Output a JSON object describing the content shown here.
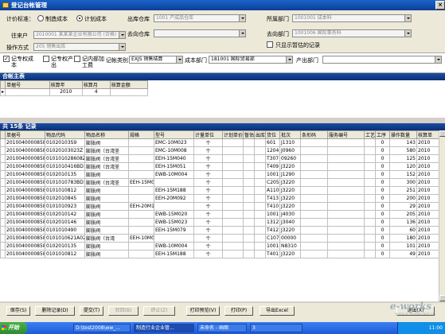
{
  "window": {
    "title": "登记台帐管理"
  },
  "form": {
    "pricing_label": "计价标准：",
    "pricing_options": [
      "制造成本",
      "计划成本"
    ],
    "from_warehouse_label": "出库仓库",
    "from_warehouse_value": "1001 产成品仓库",
    "department_label": "所属部门",
    "department_value": "1001001 成本科",
    "partner_label": "往来户",
    "partner_value": "2010001 某某某企业有限公司 (合格)",
    "to_warehouse_label": "去向仓库",
    "to_warehouse_value": "",
    "to_department_label": "去向部门",
    "to_department_value": "1001006 国际事务科",
    "operation_label": "操作方式",
    "operation_value": "205 销售出库",
    "only_unregistered_label": "只显示暂估的记录"
  },
  "band": {
    "record_cost_label": "记专权成本",
    "exclude_label": "记专权产出",
    "record_processing_label": "记内部加工费",
    "type_label": "记帐类别",
    "type_value": "EXJS 销售结算",
    "cost_dept_label": "成本部门",
    "cost_dept_value": "181001 国际贸易部",
    "output_dept_label": "产出部门",
    "output_dept_value": ""
  },
  "summary": {
    "title": "合帐主表",
    "headers": [
      "单据号",
      "核算年",
      "核算月",
      "核算金额"
    ],
    "rows": [
      [
        "",
        "2010",
        "4",
        ""
      ]
    ]
  },
  "detail": {
    "title": "共 15条 记录",
    "headers": [
      "单据号",
      "物品代码",
      "物品名称",
      "规格",
      "型号",
      "计量单位",
      "计划单价",
      "暂估",
      "出库",
      "货位",
      "批次",
      "条形码",
      "服务编号",
      "工艺",
      "工序",
      "操作数量",
      "核算单"
    ],
    "rows": [
      [
        "2010040000858",
        "01020103S9",
        "膨胀阀",
        "",
        "EMC-10M023",
        "个",
        "",
        "",
        "",
        "601",
        "J1310",
        "",
        "",
        "",
        "0",
        "143",
        "2010"
      ],
      [
        "2010040000858",
        "01020103023Z",
        "膨胀阀（台湾荃",
        "",
        "EMC-10M008",
        "个",
        "",
        "",
        "",
        "1204",
        "J0960",
        "",
        "",
        "",
        "0",
        "580",
        "2010"
      ],
      [
        "2010040000858",
        "010101028608Z",
        "膨胀阀（台湾荃",
        "",
        "EEH-15M040",
        "个",
        "",
        "",
        "",
        "T307",
        "09260",
        "",
        "",
        "",
        "0",
        "125",
        "2010"
      ],
      [
        "2010040000858",
        "0101010416BD1",
        "膨胀阀（台湾荃",
        "",
        "EEH-15M051",
        "个",
        "",
        "",
        "",
        "T409",
        "J3220",
        "",
        "",
        "",
        "0",
        "120",
        "2010"
      ],
      [
        "2010040000858",
        "0102010135",
        "膨胀阀",
        "",
        "EWB-10M004",
        "个",
        "",
        "",
        "",
        "1001",
        "J1290",
        "",
        "",
        "",
        "0",
        "152",
        "2010"
      ],
      [
        "2010040000858",
        "0101010783BD1",
        "膨胀阀（台湾荃",
        "EEH-15M0",
        "",
        "个",
        "",
        "",
        "",
        "C205",
        "J3220",
        "",
        "",
        "",
        "0",
        "300",
        "2010"
      ],
      [
        "2010040000858",
        "0101010812",
        "膨胀阀",
        "",
        "EEH-15M188",
        "个",
        "",
        "",
        "",
        "A110",
        "J3220",
        "",
        "",
        "",
        "0",
        "251",
        "2010"
      ],
      [
        "2010040000858",
        "0102010845",
        "膨胀阀",
        "",
        "EEH-20M092",
        "个",
        "",
        "",
        "",
        "T413",
        "J3220",
        "",
        "",
        "",
        "0",
        "200",
        "2010"
      ],
      [
        "2010040000858",
        "0101010923",
        "膨胀阀",
        "EEH-20M1",
        "",
        "个",
        "",
        "",
        "",
        "T410",
        "J3220",
        "",
        "",
        "",
        "0",
        "29",
        "2010"
      ],
      [
        "2010040000858",
        "0102010142",
        "膨胀阀",
        "",
        "EWB-15M020",
        "个",
        "",
        "",
        "",
        "1001",
        "J4030",
        "",
        "",
        "",
        "0",
        "205",
        "2010"
      ],
      [
        "2010040000858",
        "0102010146",
        "膨胀阀",
        "",
        "EWB-15M023",
        "个",
        "",
        "",
        "",
        "1312",
        "J3040",
        "",
        "",
        "",
        "0",
        "136",
        "2010"
      ],
      [
        "2010040000858",
        "0101010490",
        "膨胀阀",
        "",
        "EEH-15M079",
        "个",
        "",
        "",
        "",
        "T412",
        "J3220",
        "",
        "",
        "",
        "0",
        "60",
        "2010"
      ],
      [
        "2010040000858",
        "0101010621A02",
        "膨胀阀（台湾",
        "EEH-10M0",
        "",
        "个",
        "",
        "",
        "",
        "C107",
        "00000",
        "",
        "",
        "",
        "0",
        "180",
        "2010"
      ],
      [
        "2010040000858",
        "0102010135",
        "膨胀阀",
        "",
        "EWB-10M004",
        "个",
        "",
        "",
        "",
        "1001",
        "N8310",
        "",
        "",
        "",
        "0",
        "101",
        "2010"
      ],
      [
        "2010040000858",
        "0101010812",
        "膨胀阀",
        "",
        "EEH-15M188",
        "个",
        "",
        "",
        "",
        "T401",
        "J3220",
        "",
        "",
        "",
        "0",
        "49",
        "2010"
      ]
    ]
  },
  "toolbar": {
    "buttons": [
      {
        "label": "保存(S)",
        "enabled": true
      },
      {
        "label": "删除记录(D)",
        "enabled": true
      },
      {
        "label": "提交(T)",
        "enabled": true
      },
      {
        "label": "驳回(B)",
        "enabled": false
      },
      {
        "label": "终止(Z)",
        "enabled": false
      },
      {
        "label": "打印预览(V)",
        "enabled": true
      },
      {
        "label": "打印(P)",
        "enabled": true
      },
      {
        "label": "导出Excel",
        "enabled": true
      }
    ],
    "exit_label": "退出(X)"
  },
  "taskbar": {
    "start_label": "开始",
    "tasks": [
      "D:\\test2008\\ww_...",
      "制造行业企业管...",
      "未命名 - 画图",
      "3"
    ],
    "clock": "11:00"
  },
  "watermark": {
    "brand": "e-works",
    "url": "www.e-works.net.cn"
  }
}
